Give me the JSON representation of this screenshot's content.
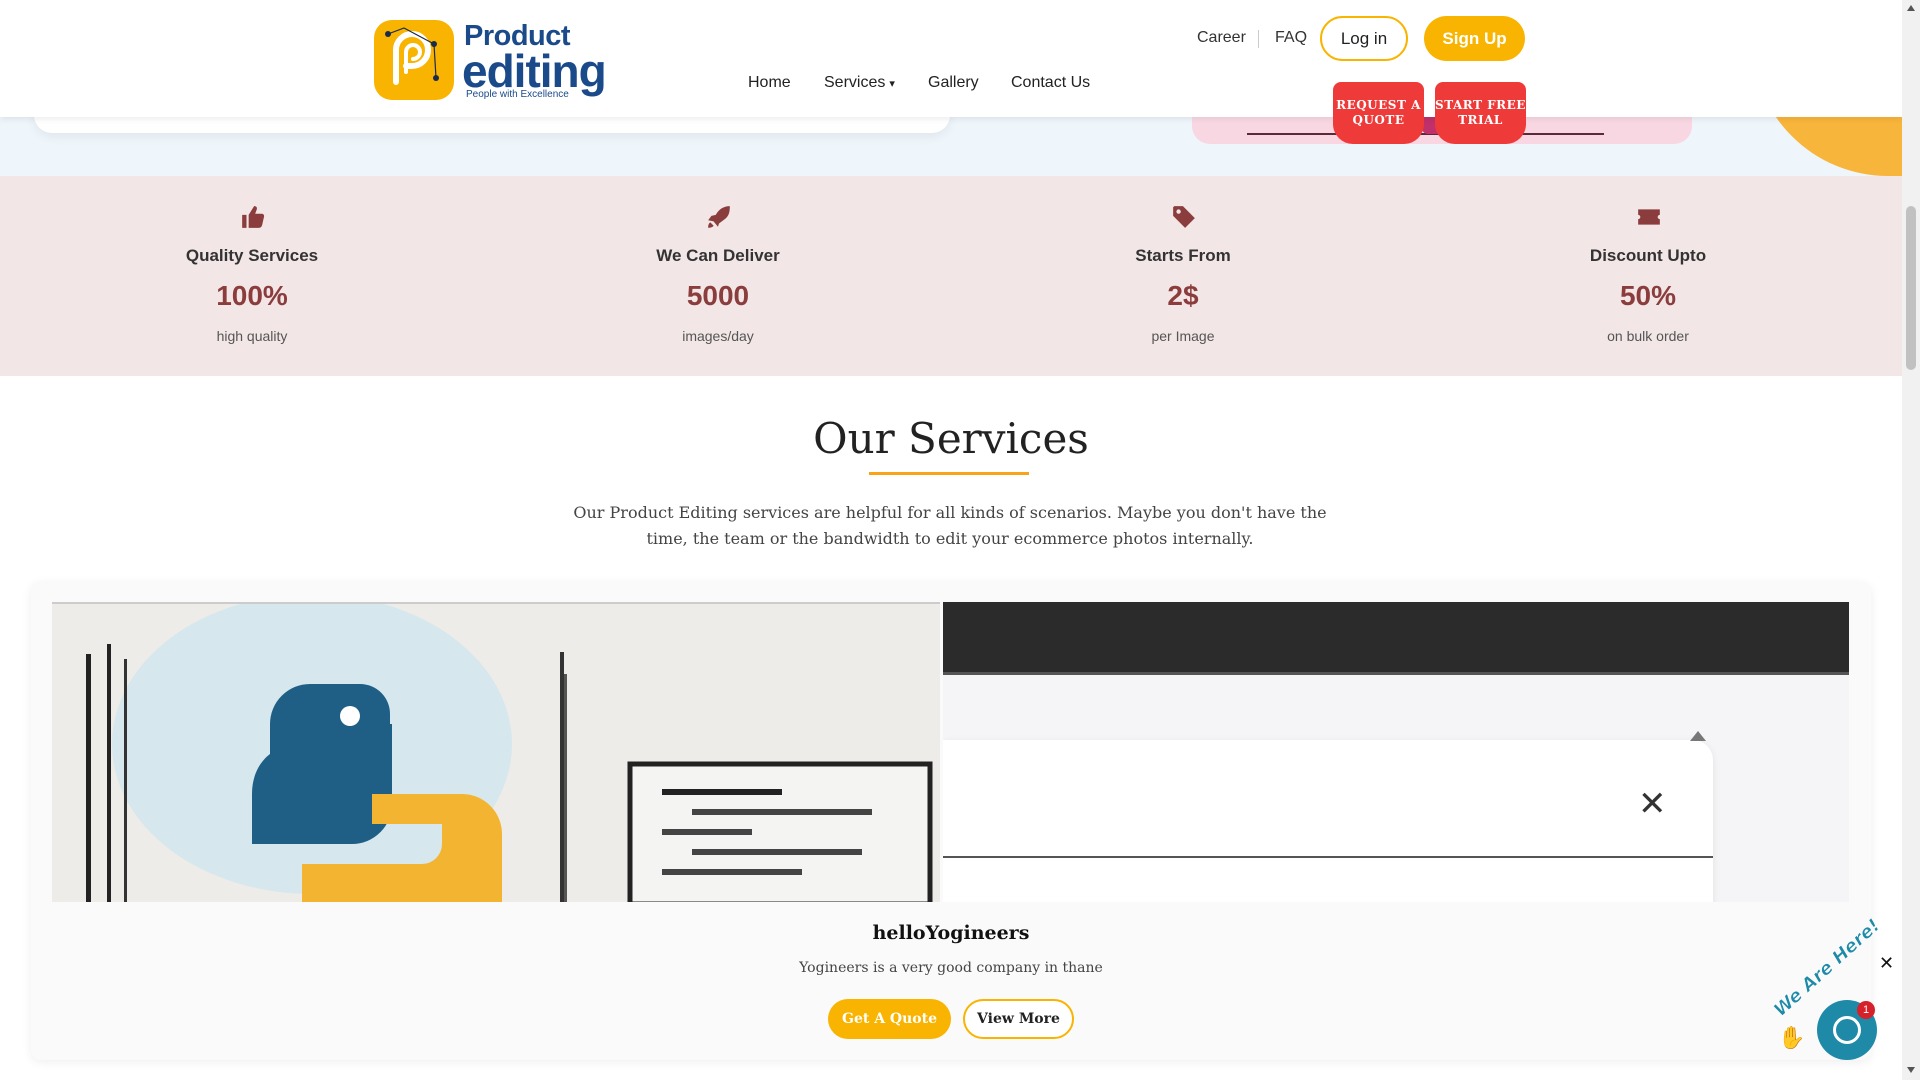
{
  "header": {
    "logo": {
      "line1": "Product",
      "line2": "editing",
      "tagline": "People with Excellence"
    },
    "top_links": {
      "career": "Career",
      "faq": "FAQ"
    },
    "login_label": "Log in",
    "signup_label": "Sign Up",
    "nav": {
      "home": "Home",
      "services": "Services",
      "services_caret": "▾",
      "gallery": "Gallery",
      "contact": "Contact Us"
    },
    "request_quote": {
      "line1": "REQUEST A",
      "line2": "QUOTE"
    },
    "free_trial": {
      "line1": "START FREE",
      "line2": "TRIAL"
    }
  },
  "stats": [
    {
      "icon": "thumbs-up-icon",
      "title": "Quality Services",
      "value": "100%",
      "sub": "high quality"
    },
    {
      "icon": "rocket-icon",
      "title": "We Can Deliver",
      "value": "5000",
      "sub": "images/day"
    },
    {
      "icon": "tag-icon",
      "title": "Starts From",
      "value": "2$",
      "sub": "per Image"
    },
    {
      "icon": "ticket-icon",
      "title": "Discount Upto",
      "value": "50%",
      "sub": "on bulk order"
    }
  ],
  "services": {
    "title": "Our Services",
    "description": "Our Product Editing services are helpful for all kinds of scenarios. Maybe you don't have the time, the team or the bandwidth to edit your ecommerce photos internally.",
    "card": {
      "title": "helloYogineers",
      "text": "Yogineers is a very good company in thane",
      "quote_label": "Get A Quote",
      "more_label": "View More",
      "close_glyph": "✕"
    }
  },
  "chat": {
    "ribbon": "We Are Here!",
    "badge": "1",
    "close_glyph": "✕"
  },
  "colors": {
    "accent": "#f8b400",
    "brand_blue": "#1a4a8a",
    "cta_red": "#ef3a3a",
    "stat_value": "#8b3d3d",
    "stats_bg": "#f2e6e6",
    "chat_teal": "#1f8aa8"
  }
}
